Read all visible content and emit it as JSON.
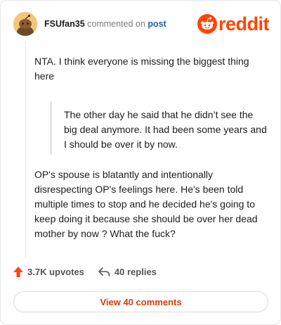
{
  "header": {
    "username": "FSUfan35",
    "commented_on": "commented on",
    "post_link": "post"
  },
  "brand": {
    "wordmark": "reddit",
    "color": "#ff4500"
  },
  "comment": {
    "paragraph_1": "NTA. I think everyone is missing the biggest thing here",
    "quote": "The other day he said that he didn’t see the big deal anymore. It had been some years and I should be over it by now.",
    "paragraph_2": "OP's spouse is blatantly and intentionally disrespecting OP's feelings here. He's been told multiple times to stop and he decided he's going to keep doing it because she should be over her dead mother by now ? What the fuck?"
  },
  "actions": {
    "upvotes_label": "3.7K upvotes",
    "replies_label": "40 replies",
    "upvote_icon": "upvote-arrow-icon",
    "reply_icon": "reply-icon",
    "upvote_color": "#ff4500"
  },
  "footer": {
    "view_comments_label": "View 40 comments",
    "accent_color": "#d93a00"
  }
}
